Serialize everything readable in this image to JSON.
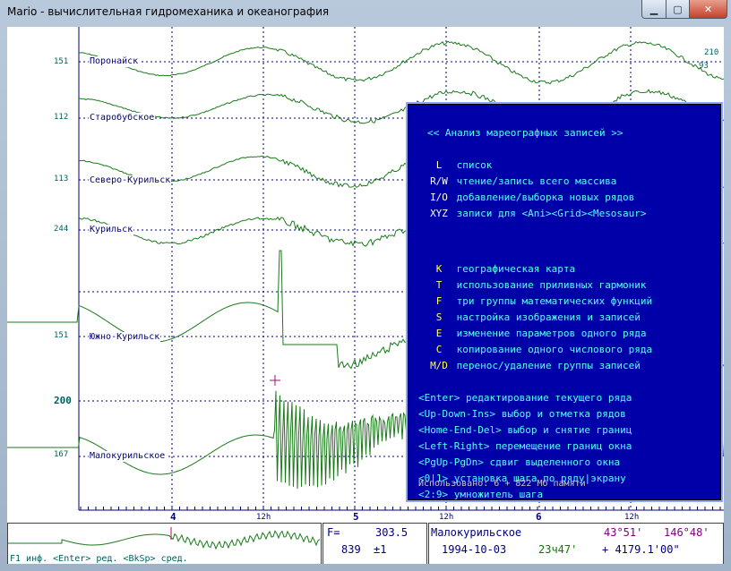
{
  "window": {
    "title": "Mario - вычислительная гидромеханика и океанография"
  },
  "stations": [
    {
      "name": "Поронайск",
      "scale": "151"
    },
    {
      "name": "Старобубское",
      "scale": "112"
    },
    {
      "name": "Северо-Курильск",
      "scale": "113"
    },
    {
      "name": "Курильск",
      "scale": "244"
    },
    {
      "name": "Южно-Курильск",
      "scale": "151"
    },
    {
      "name": "Малокурильское",
      "scale": "167"
    }
  ],
  "scale_200": "200",
  "right_values": [
    "210",
    "93"
  ],
  "time_axis": {
    "major": [
      "4",
      "5",
      "6"
    ],
    "minor": "12h"
  },
  "menu": {
    "header": "<< Анализ мареографных записей >>",
    "group1": [
      {
        "key": "L",
        "desc": "список"
      },
      {
        "key": "R/W",
        "desc": "чтение/запись всего массива"
      },
      {
        "key": "I/O",
        "desc": "добавление/выборка новых рядов"
      },
      {
        "key": "XYZ",
        "desc": "записи для <Ani><Grid><Mesosaur>"
      }
    ],
    "group2": [
      {
        "key": "K",
        "desc": "географическая карта"
      },
      {
        "key": "T",
        "desc": "использование приливных гармоник"
      },
      {
        "key": "F",
        "desc": "три группы математических функций"
      },
      {
        "key": "S",
        "desc": "настройка изображения и записей"
      },
      {
        "key": "E",
        "desc": "изменение параметров одного ряда"
      },
      {
        "key": "C",
        "desc": "копирование одного числового ряда"
      },
      {
        "key": "M/D",
        "desc": "перенос/удаление группы записей"
      }
    ],
    "group3": [
      {
        "key": "<Enter>",
        "desc": "редактирование текущего ряда"
      },
      {
        "key": "<Up-Down-Ins>",
        "desc": "выбор и отметка рядов"
      },
      {
        "key": "<Home-End-Del>",
        "desc": "выбор и снятие границ"
      },
      {
        "key": "<Left-Right>",
        "desc": "перемещение границ окна"
      },
      {
        "key": "<PgUp-PgDn>",
        "desc": "сдвиг выделенного окна"
      },
      {
        "key": "<0|1>",
        "desc": "установка шага по ряду|экрану"
      },
      {
        "key": "<2:9>",
        "desc": "умножитель шага"
      }
    ],
    "footer": "Использовано: 6 + 822 Мб памяти"
  },
  "status": {
    "hint": "F1 инф. <Enter> ред. <BkSp> сред.",
    "f_label": "F=",
    "f_value": "303.5",
    "count": "839",
    "step": "±1",
    "station": "Малокурильское",
    "lat": "43°51'",
    "lon": "146°48'",
    "date": "1994-10-03",
    "time": "23ч47'",
    "offset": "+ 4179.1'00\""
  }
}
